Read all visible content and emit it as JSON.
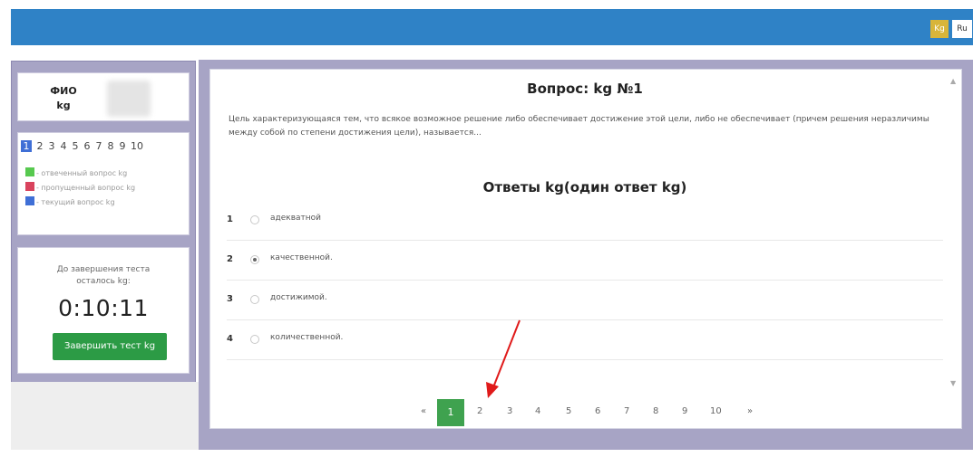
{
  "header": {
    "lang_kg": "Kg",
    "lang_ru": "Ru"
  },
  "sidebar": {
    "fio_label_line1": "ФИО",
    "fio_label_line2": "kg",
    "question_numbers": [
      "1",
      "2",
      "3",
      "4",
      "5",
      "6",
      "7",
      "8",
      "9",
      "10"
    ],
    "current_question": "1",
    "legend": {
      "answered": "- отвеченный вопрос kg",
      "skipped": "- пропущенный вопрос kg",
      "current": "- текущий вопрос kg"
    },
    "timer_caption_line1": "До завершения теста",
    "timer_caption_line2": "осталось kg:",
    "timer": "0:10:11",
    "finish_button": "Завершить тест kg"
  },
  "question": {
    "title": "Вопрос: kg №1",
    "text": "Цель характеризующаяся тем, что всякое возможное решение либо обеспечивает достижение этой цели, либо не обеспечивает (причем решения неразличимы между собой по степени достижения цели), называется...",
    "answers_title": "Ответы kg(один ответ kg)",
    "answers": [
      {
        "num": "1",
        "label": "адекватной",
        "checked": false
      },
      {
        "num": "2",
        "label": "качественной.",
        "checked": true
      },
      {
        "num": "3",
        "label": "достижимой.",
        "checked": false
      },
      {
        "num": "4",
        "label": "количественной.",
        "checked": false
      }
    ]
  },
  "pagination": {
    "prev": "«",
    "pages": [
      "1",
      "2",
      "3",
      "4",
      "5",
      "6",
      "7",
      "8",
      "9",
      "10"
    ],
    "active": "1",
    "next": "»"
  },
  "colors": {
    "topbar": "#2f82c6",
    "answered": "#57c94f",
    "skipped": "#d9435d",
    "current": "#3f6fd6",
    "finish_button": "#2c9b45",
    "active_page": "#3fa24f",
    "arrow": "#e01a1a"
  }
}
